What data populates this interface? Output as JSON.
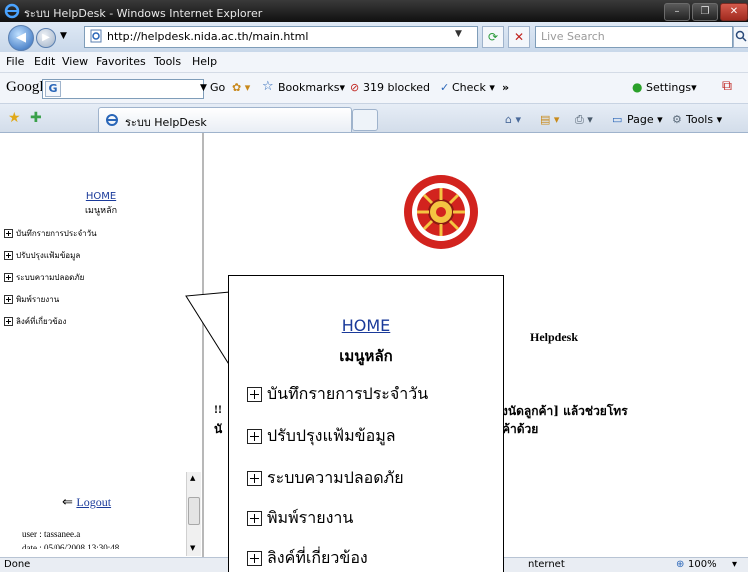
{
  "window": {
    "title": "ระบบ HelpDesk - Windows Internet Explorer",
    "buttons": [
      "–",
      "❐",
      "✕"
    ]
  },
  "address_bar": {
    "url": "http://helpdesk.nida.ac.th/main.html",
    "search_placeholder": "Live Search"
  },
  "menu": [
    "File",
    "Edit",
    "View",
    "Favorites",
    "Tools",
    "Help"
  ],
  "google_toolbar": {
    "logo": "Google",
    "go": "Go",
    "bookmarks": "Bookmarks▾",
    "blocked": "319 blocked",
    "check": "Check ▾",
    "more": "»",
    "settings": "Settings▾"
  },
  "tab": {
    "title": "ระบบ HelpDesk",
    "page": "Page ▾",
    "tools": "Tools ▾"
  },
  "left_nav": {
    "home": "HOME",
    "menu_title": "เมนูหลัก",
    "items": [
      "บันทึกรายการประจำวัน",
      "ปรับปรุงแฟ้มข้อมูล",
      "ระบบความปลอดภัย",
      "พิมพ์รายงาน",
      "ลิงค์ที่เกี่ยวข้อง"
    ],
    "logout": "Logout",
    "user": "user : tassanee.a",
    "date": "date : 05/06/2008 13:30:48"
  },
  "main": {
    "helpdesk_heading": "Helpdesk",
    "notice_line1_start": "!!",
    "notice_line1_end": "งนัดลูกค้า] แล้วช่วยโทร",
    "notice_line2_start": "นั",
    "notice_line2_end": "ค้าด้วย"
  },
  "status_bar": {
    "left": "Done",
    "zone": "nternet",
    "zoom": "100%",
    "zoom_arrow": "▾"
  },
  "colors": {
    "link": "#1a3a9a",
    "seal_red": "#d2231e",
    "title_bar": "#1e1e1e"
  }
}
